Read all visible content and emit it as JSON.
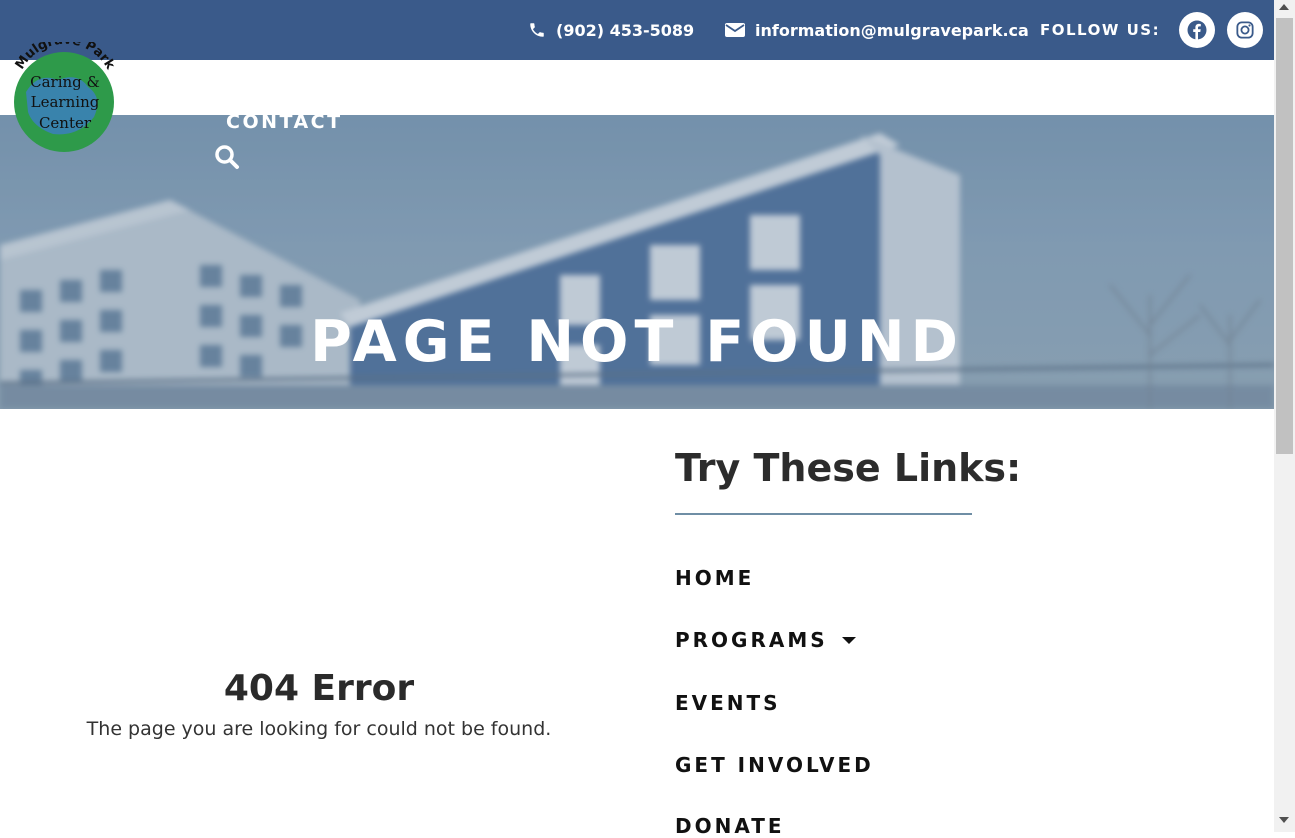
{
  "topbar": {
    "phone": "(902) 453-5089",
    "email": "information@mulgravepark.ca",
    "follow_label": "FOLLOW US:",
    "social": [
      "facebook-icon",
      "instagram-icon"
    ],
    "bg_color": "#3a5a8a"
  },
  "logo": {
    "arc_text": "Mulgrave Park",
    "line1": "Caring &",
    "line2": "Learning",
    "line3": "Center"
  },
  "nav": {
    "contact": "CONTACT",
    "search_icon": "search-icon"
  },
  "hero": {
    "title": "PAGE NOT FOUND"
  },
  "error": {
    "title": "404 Error",
    "message": "The page you are looking for could not be found."
  },
  "links": {
    "heading": "Try These Links:",
    "items": [
      {
        "label": "HOME"
      },
      {
        "label": "PROGRAMS",
        "has_dropdown": true
      },
      {
        "label": "EVENTS"
      },
      {
        "label": "GET INVOLVED"
      },
      {
        "label": "DONATE"
      }
    ]
  }
}
